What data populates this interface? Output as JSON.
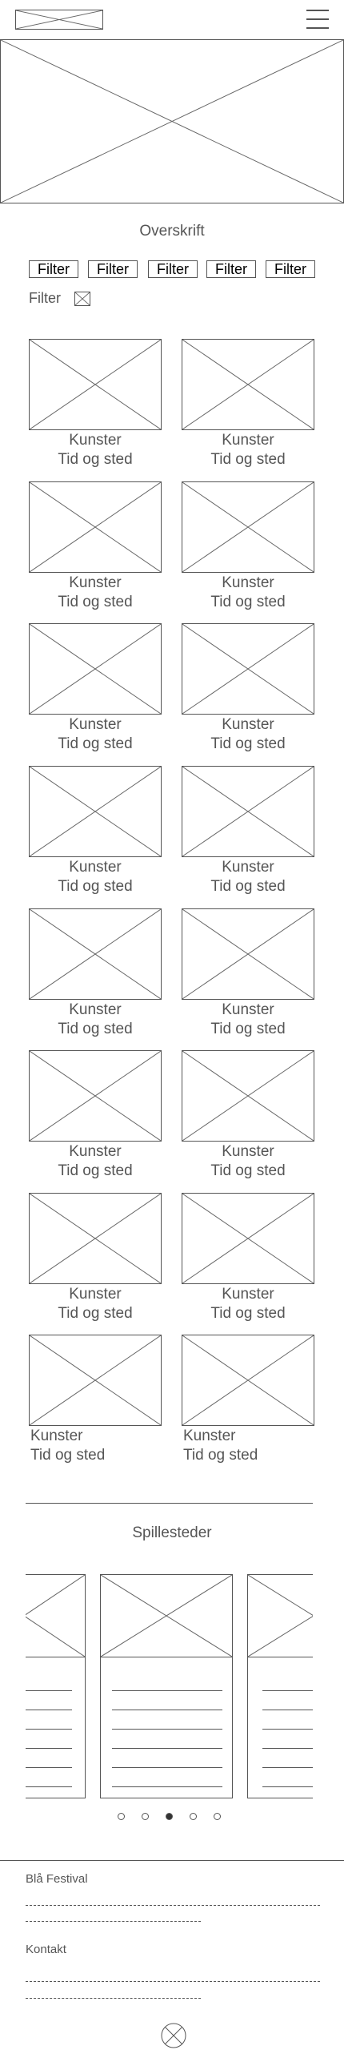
{
  "header": {
    "logo_icon": "image-placeholder-icon",
    "menu_icon": "hamburger-menu-icon"
  },
  "hero": {
    "icon": "image-placeholder-icon"
  },
  "heading": "Overskrift",
  "filters": [
    "Filter",
    "Filter",
    "Filter",
    "Filter",
    "Filter"
  ],
  "active_filter": {
    "label": "Filter",
    "remove_icon": "close-box-icon"
  },
  "events": [
    {
      "artist": "Kunster",
      "time_place": "Tid og sted"
    },
    {
      "artist": "Kunster",
      "time_place": "Tid og sted"
    },
    {
      "artist": "Kunster",
      "time_place": "Tid og sted"
    },
    {
      "artist": "Kunster",
      "time_place": "Tid og sted"
    },
    {
      "artist": "Kunster",
      "time_place": "Tid og sted"
    },
    {
      "artist": "Kunster",
      "time_place": "Tid og sted"
    },
    {
      "artist": "Kunster",
      "time_place": "Tid og sted"
    },
    {
      "artist": "Kunster",
      "time_place": "Tid og sted"
    },
    {
      "artist": "Kunster",
      "time_place": "Tid og sted"
    },
    {
      "artist": "Kunster",
      "time_place": "Tid og sted"
    },
    {
      "artist": "Kunster",
      "time_place": "Tid og sted"
    },
    {
      "artist": "Kunster",
      "time_place": "Tid og sted"
    },
    {
      "artist": "Kunster",
      "time_place": "Tid og sted"
    },
    {
      "artist": "Kunster",
      "time_place": "Tid og sted"
    },
    {
      "artist": "Kunster",
      "time_place": "Tid og sted"
    },
    {
      "artist": "Kunster",
      "time_place": "Tid og sted"
    }
  ],
  "venues": {
    "title": "Spillesteder",
    "slide_count": 5,
    "active_slide": 3
  },
  "footer": {
    "festival_title": "Blå Festival",
    "contact_title": "Kontakt",
    "close_icon": "close-circle-icon"
  }
}
